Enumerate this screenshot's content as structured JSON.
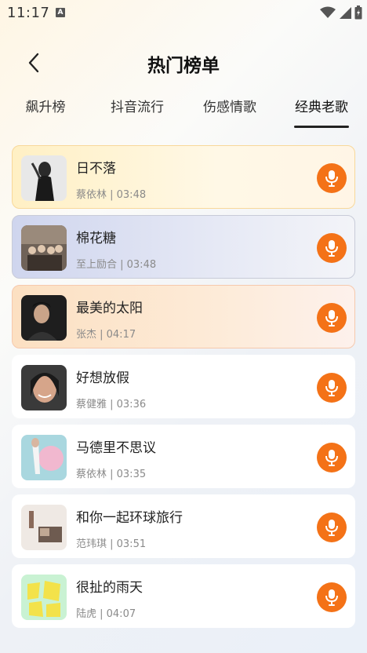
{
  "status": {
    "time": "11:17",
    "indicator": "A"
  },
  "header": {
    "title": "热门榜单"
  },
  "tabs": [
    {
      "label": "飙升榜"
    },
    {
      "label": "抖音流行"
    },
    {
      "label": "伤感情歌"
    },
    {
      "label": "经典老歌"
    }
  ],
  "active_tab": "经典老歌",
  "songs": [
    {
      "title": "日不落",
      "meta": "蔡依林 | 03:48"
    },
    {
      "title": "棉花糖",
      "meta": "至上励合 | 03:48"
    },
    {
      "title": "最美的太阳",
      "meta": "张杰 | 04:17"
    },
    {
      "title": "好想放假",
      "meta": "蔡健雅 | 03:36"
    },
    {
      "title": "马德里不思议",
      "meta": "蔡依林 | 03:35"
    },
    {
      "title": "和你一起环球旅行",
      "meta": "范玮琪 | 03:51"
    },
    {
      "title": "很扯的雨天",
      "meta": "陆虎 | 04:07"
    }
  ],
  "colors": {
    "accent": "#f47217"
  },
  "icons": {
    "back": "chevron-left-icon",
    "action": "microphone-icon"
  }
}
